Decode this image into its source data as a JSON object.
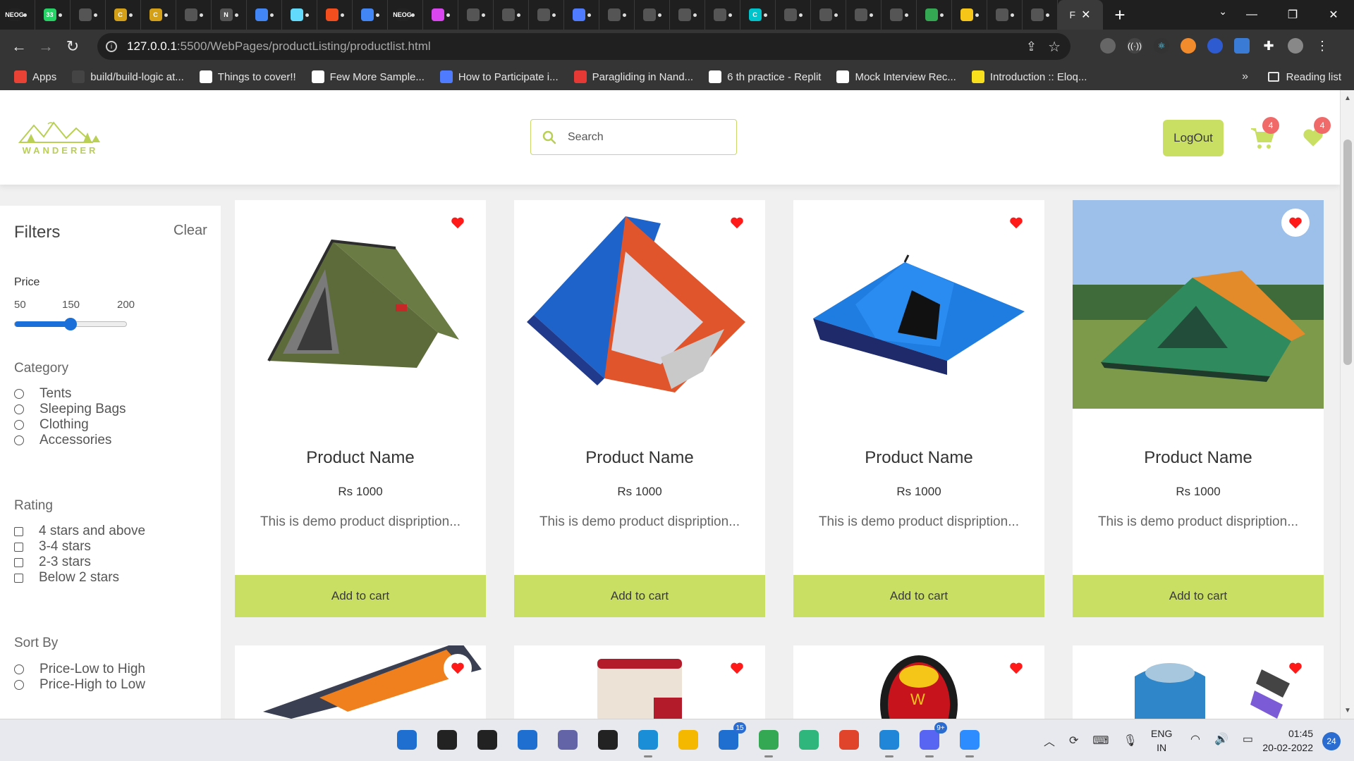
{
  "browser": {
    "tabs": [
      {
        "icon": "neog-icon",
        "color": "#222222",
        "label": "NEOG"
      },
      {
        "icon": "whatsapp-icon",
        "color": "#25d366",
        "label": "33"
      },
      {
        "icon": "globe-icon",
        "color": "#ffffff",
        "label": ""
      },
      {
        "icon": "c-icon",
        "color": "#d4a017",
        "label": "C"
      },
      {
        "icon": "c-icon",
        "color": "#d4a017",
        "label": "C"
      },
      {
        "icon": "github-icon",
        "color": "#555555",
        "label": ""
      },
      {
        "icon": "notion-icon",
        "color": "#ffffff",
        "label": "N"
      },
      {
        "icon": "chrome-icon",
        "color": "#4285f4",
        "label": ""
      },
      {
        "icon": "react-icon",
        "color": "#61dafb",
        "label": ""
      },
      {
        "icon": "figma-icon",
        "color": "#f24e1e",
        "label": ""
      },
      {
        "icon": "docs-icon",
        "color": "#4285f4",
        "label": ""
      },
      {
        "icon": "neog-icon",
        "color": "#222222",
        "label": "NEOG"
      },
      {
        "icon": "app-icon",
        "color": "#d946ef",
        "label": ""
      },
      {
        "icon": "cube-icon",
        "color": "#ffffff",
        "label": ""
      },
      {
        "icon": "cube-icon",
        "color": "#ffffff",
        "label": ""
      },
      {
        "icon": "cube-icon",
        "color": "#ffffff",
        "label": ""
      },
      {
        "icon": "flag-icon",
        "color": "#4f7cff",
        "label": ""
      },
      {
        "icon": "globe-icon",
        "color": "#ffffff",
        "label": ""
      },
      {
        "icon": "github-icon",
        "color": "#555555",
        "label": ""
      },
      {
        "icon": "globe-icon",
        "color": "#ffffff",
        "label": ""
      },
      {
        "icon": "globe-icon",
        "color": "#ffffff",
        "label": ""
      },
      {
        "icon": "canva-icon",
        "color": "#00c4cc",
        "label": "C"
      },
      {
        "icon": "globe-icon",
        "color": "#ffffff",
        "label": ""
      },
      {
        "icon": "github-icon",
        "color": "#555555",
        "label": ""
      },
      {
        "icon": "chrome-icon",
        "color": "#ffffff",
        "label": ""
      },
      {
        "icon": "github-icon",
        "color": "#555555",
        "label": ""
      },
      {
        "icon": "sheets-icon",
        "color": "#34a853",
        "label": ""
      },
      {
        "icon": "bolt-icon",
        "color": "#f5c518",
        "label": ""
      },
      {
        "icon": "globe-icon",
        "color": "#ffffff",
        "label": ""
      },
      {
        "icon": "globe-icon",
        "color": "#ffffff",
        "label": ""
      }
    ],
    "active_tab": {
      "title": "F"
    },
    "url": {
      "host": "127.0.0.1",
      "path": ":5500/WebPages/productListing/productlist.html"
    },
    "bookmarks": [
      {
        "icon": "apps-icon",
        "label": "Apps",
        "color": "#ea4335"
      },
      {
        "icon": "github-icon",
        "label": "build/build-logic at...",
        "color": "#444444"
      },
      {
        "icon": "notion-icon",
        "label": "Things to cover!!",
        "color": "#ffffff"
      },
      {
        "icon": "notion-icon",
        "label": "Few More Sample...",
        "color": "#ffffff"
      },
      {
        "icon": "devpost-icon",
        "label": "How to Participate i...",
        "color": "#4f7cff"
      },
      {
        "icon": "paraglide-icon",
        "label": "Paragliding in Nand...",
        "color": "#e53935"
      },
      {
        "icon": "replit-icon",
        "label": "6 th practice - Replit",
        "color": "#ffffff"
      },
      {
        "icon": "notion-icon",
        "label": "Mock Interview Rec...",
        "color": "#ffffff"
      },
      {
        "icon": "js-icon",
        "label": "Introduction :: Eloq...",
        "color": "#f7df1e"
      }
    ],
    "more": "»",
    "reading_list": "Reading list"
  },
  "header": {
    "logo_text": "WANDERER",
    "search_placeholder": "Search",
    "logout_label": "LogOut",
    "cart_count": "4",
    "wishlist_count": "4",
    "accent": "#c8df63"
  },
  "filters": {
    "title": "Filters",
    "clear": "Clear",
    "price": {
      "label": "Price",
      "ticks": [
        "50",
        "150",
        "200"
      ],
      "value_fraction": 0.5
    },
    "category": {
      "label": "Category",
      "options": [
        "Tents",
        "Sleeping Bags",
        "Clothing",
        "Accessories"
      ]
    },
    "rating": {
      "label": "Rating",
      "options": [
        "4 stars and above",
        "3-4 stars",
        "2-3 stars",
        "Below 2 stars"
      ]
    },
    "sort": {
      "label": "Sort By",
      "options": [
        "Price-Low to High",
        "Price-High to Low"
      ]
    }
  },
  "products": [
    {
      "name": "Product Name",
      "price": "Rs 1000",
      "desc": "This is demo product dispription...",
      "cta": "Add to cart",
      "image": "green-dome-tent"
    },
    {
      "name": "Product Name",
      "price": "Rs 1000",
      "desc": "This is demo product dispription...",
      "cta": "Add to cart",
      "image": "blue-orange-tent"
    },
    {
      "name": "Product Name",
      "price": "Rs 1000",
      "desc": "This is demo product dispription...",
      "cta": "Add to cart",
      "image": "blue-instant-tent"
    },
    {
      "name": "Product Name",
      "price": "Rs 1000",
      "desc": "This is demo product dispription...",
      "cta": "Add to cart",
      "image": "tent-on-grass-photo"
    }
  ],
  "products_row2": [
    {
      "image": "orange-sleeping-bag"
    },
    {
      "image": "red-sleeping-bag"
    },
    {
      "image": "wildcraft-sleeping-bag"
    },
    {
      "image": "blue-sleeping-bag-set"
    }
  ],
  "taskbar": {
    "apps": [
      {
        "icon": "windows-start-icon",
        "color": "#1f6fd1",
        "badge": ""
      },
      {
        "icon": "search-icon",
        "color": "#222222",
        "badge": ""
      },
      {
        "icon": "task-view-icon",
        "color": "#222222",
        "badge": ""
      },
      {
        "icon": "widgets-icon",
        "color": "#1f6fd1",
        "badge": ""
      },
      {
        "icon": "teams-chat-icon",
        "color": "#6264a7",
        "badge": ""
      },
      {
        "icon": "dropbox-icon",
        "color": "#222222",
        "badge": ""
      },
      {
        "icon": "edge-icon",
        "color": "#1a8fd8",
        "badge": ""
      },
      {
        "icon": "file-explorer-icon",
        "color": "#f5b800",
        "badge": ""
      },
      {
        "icon": "mail-icon",
        "color": "#1f6fd1",
        "badge": "15"
      },
      {
        "icon": "chrome-icon",
        "color": "#34a853",
        "badge": ""
      },
      {
        "icon": "atom-icon",
        "color": "#2fb67c",
        "badge": ""
      },
      {
        "icon": "office-icon",
        "color": "#e0442a",
        "badge": ""
      },
      {
        "icon": "vscode-icon",
        "color": "#1f86d8",
        "badge": ""
      },
      {
        "icon": "discord-icon",
        "color": "#5865f2",
        "badge": "9+"
      },
      {
        "icon": "zoom-icon",
        "color": "#2d8cff",
        "badge": ""
      }
    ],
    "lang_line1": "ENG",
    "lang_line2": "IN",
    "time": "01:45",
    "date": "20-02-2022",
    "notifications": "24"
  }
}
